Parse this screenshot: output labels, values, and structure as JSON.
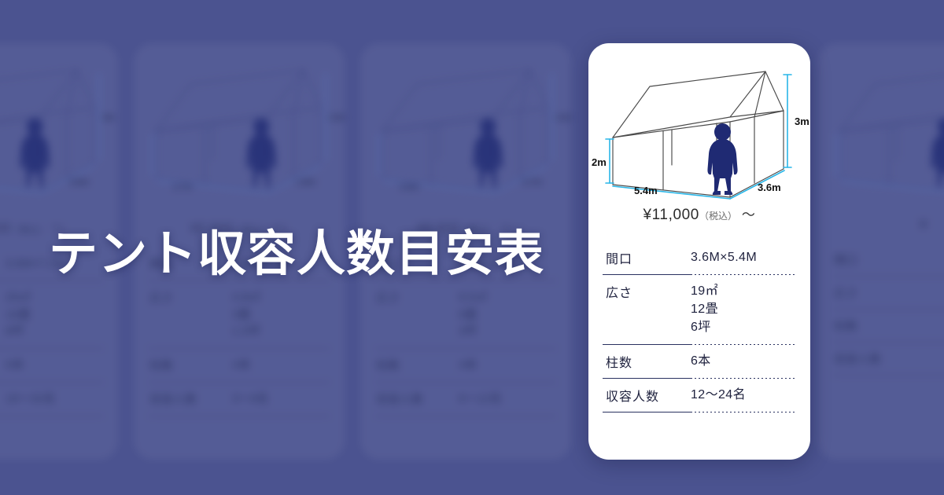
{
  "page": {
    "title": "テント収容人数目安表",
    "background_color": "#4b5390",
    "card_background": "#ffffff",
    "accent_dimension_color": "#29b6e8",
    "text_color": "#20233f"
  },
  "featured_card": {
    "illustration": {
      "name": "tent-diagram",
      "dim_height_left": "2m",
      "dim_height_right": "3m",
      "dim_width": "5.4m",
      "dim_depth": "3.6m"
    },
    "price": {
      "amount": "¥11,000",
      "tax_note": "（税込）",
      "suffix": "〜"
    },
    "table": {
      "rows": [
        {
          "label": "間口",
          "values": [
            "3.6M×5.4M"
          ]
        },
        {
          "label": "広さ",
          "values": [
            "19㎡",
            "12畳",
            "6坪"
          ]
        },
        {
          "label": "柱数",
          "values": [
            "6本"
          ]
        },
        {
          "label": "収容人数",
          "values": [
            "12〜24名"
          ]
        }
      ]
    }
  },
  "background_cards": [
    {
      "illustration": {
        "dim_height_right": "3m",
        "dim_depth": "3.6m"
      },
      "price": {
        "amount": "¥23,100",
        "tax_note": "（税込）",
        "suffix": "〜"
      },
      "table": {
        "rows": [
          {
            "label": "間口",
            "values": [
              "3.6M×7.2M"
            ]
          },
          {
            "label": "広さ",
            "values": [
              "25㎡",
              "16畳",
              "8坪"
            ]
          },
          {
            "label": "柱数",
            "values": [
              "6本"
            ]
          },
          {
            "label": "収容人数",
            "values": [
              "16〜32名"
            ]
          }
        ]
      }
    },
    {
      "illustration": {
        "dim_height_right": "2.6m",
        "dim_depth": "1.8m",
        "dim_width": "2.7m"
      },
      "price": {
        "amount": "¥5,500",
        "tax_note": "（税込）",
        "suffix": "〜"
      },
      "table": {
        "rows": [
          {
            "label": "間口",
            "values": [
              "1.8M×2.7M"
            ]
          },
          {
            "label": "広さ",
            "values": [
              "4.8㎡",
              "3畳",
              "1.5坪"
            ]
          },
          {
            "label": "柱数",
            "values": [
              "4本"
            ]
          },
          {
            "label": "収容人数",
            "values": [
              "3〜6名"
            ]
          }
        ]
      }
    },
    {
      "illustration": {
        "dim_height_right": "2.6m",
        "dim_depth": "2.7m",
        "dim_width": "3.6m"
      },
      "price": {
        "amount": "¥8,800",
        "tax_note": "（税込）",
        "suffix": "〜"
      },
      "table": {
        "rows": [
          {
            "label": "間口",
            "values": [
              "2.7M×3.6M"
            ]
          },
          {
            "label": "広さ",
            "values": [
              "9.5㎡",
              "6畳",
              "3坪"
            ]
          },
          {
            "label": "柱数",
            "values": [
              "4本"
            ]
          },
          {
            "label": "収容人数",
            "values": [
              "6〜12名"
            ]
          }
        ]
      }
    },
    {
      "illustration": {
        "dim_depth": "2.7m"
      },
      "price": {
        "amount": "¥",
        "tax_note": "",
        "suffix": ""
      },
      "table": {
        "rows": [
          {
            "label": "間口",
            "values": [
              ""
            ]
          },
          {
            "label": "広さ",
            "values": [
              "",
              "",
              ""
            ]
          },
          {
            "label": "柱数",
            "values": [
              ""
            ]
          },
          {
            "label": "収容人数",
            "values": [
              ""
            ]
          }
        ]
      }
    }
  ]
}
